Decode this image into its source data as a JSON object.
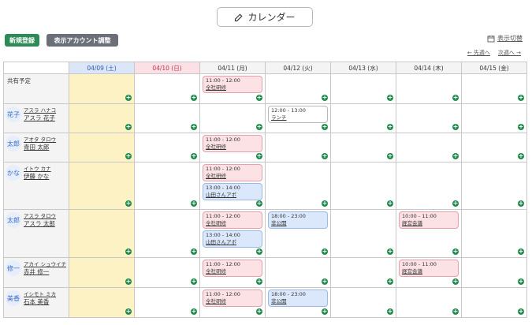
{
  "header": {
    "title": "カレンダー"
  },
  "toolbar": {
    "new_label": "新規登録",
    "account_label": "表示アカウント調整",
    "toggle_label": "表示切替",
    "prev_week": "← 先週へ",
    "next_week": "次週へ →"
  },
  "days": [
    {
      "label": "04/09 (土)",
      "kind": "sat"
    },
    {
      "label": "04/10 (日)",
      "kind": "sun"
    },
    {
      "label": "04/11 (月)",
      "kind": "wk"
    },
    {
      "label": "04/12 (火)",
      "kind": "wk"
    },
    {
      "label": "04/13 (水)",
      "kind": "wk"
    },
    {
      "label": "04/14 (木)",
      "kind": "wk"
    },
    {
      "label": "04/15 (金)",
      "kind": "wk"
    }
  ],
  "shared_label": "共有予定",
  "shared_events": [
    [],
    [],
    [
      {
        "time": "11:00 - 12:00",
        "title": "全社研修",
        "color": "red"
      }
    ],
    [],
    [],
    [],
    []
  ],
  "people": [
    {
      "avatar": "花子",
      "kana": "アスラ ハナコ",
      "name": "アスラ 花子",
      "events": [
        [],
        [],
        [],
        [
          {
            "time": "12:00 - 13:00",
            "title": "ランチ",
            "color": "white"
          }
        ],
        [],
        [],
        []
      ]
    },
    {
      "avatar": "太郎",
      "kana": "アオタ タロウ",
      "name": "青田 太郎",
      "events": [
        [],
        [],
        [
          {
            "time": "11:00 - 12:00",
            "title": "全社研修",
            "color": "red"
          }
        ],
        [],
        [],
        [],
        []
      ]
    },
    {
      "avatar": "かな",
      "kana": "イトウ カナ",
      "name": "伊藤 かな",
      "events": [
        [],
        [],
        [
          {
            "time": "11:00 - 12:00",
            "title": "全社研修",
            "color": "red"
          },
          {
            "time": "13:00 - 14:00",
            "title": "山田さんアポ",
            "color": "blue"
          }
        ],
        [],
        [],
        [],
        []
      ]
    },
    {
      "avatar": "太郎",
      "kana": "アスラ タロウ",
      "name": "アスラ 太郎",
      "events": [
        [],
        [],
        [
          {
            "time": "11:00 - 12:00",
            "title": "全社研修",
            "color": "red"
          },
          {
            "time": "13:00 - 14:00",
            "title": "山田さんアポ",
            "color": "blue"
          }
        ],
        [
          {
            "time": "18:00 - 23:00",
            "title": "非公開",
            "color": "blue"
          }
        ],
        [],
        [
          {
            "time": "10:00 - 11:00",
            "title": "経営会議",
            "color": "red"
          }
        ],
        []
      ]
    },
    {
      "avatar": "修一",
      "kana": "アカイ シュウイチ",
      "name": "赤井 修一",
      "events": [
        [],
        [],
        [
          {
            "time": "11:00 - 12:00",
            "title": "全社研修",
            "color": "red"
          }
        ],
        [],
        [],
        [
          {
            "time": "10:00 - 11:00",
            "title": "経営会議",
            "color": "red"
          }
        ],
        []
      ]
    },
    {
      "avatar": "美香",
      "kana": "イシモト ミカ",
      "name": "石本 美香",
      "events": [
        [],
        [],
        [
          {
            "time": "11:00 - 12:00",
            "title": "全社研修",
            "color": "red"
          }
        ],
        [
          {
            "time": "18:00 - 23:00",
            "title": "非公開",
            "color": "blue"
          }
        ],
        [],
        [],
        []
      ]
    }
  ],
  "icons": {
    "title": "edit-icon",
    "toggle": "calendar-icon",
    "add": "plus-circle-icon"
  },
  "colors": {
    "new_button": "#2e8b57",
    "account_button": "#6b6f78",
    "saturday": "#dbe6f8",
    "sunday": "#fbe0e6",
    "saturday_cell": "#fcf2c4",
    "add_icon": "#1f8a4c"
  }
}
